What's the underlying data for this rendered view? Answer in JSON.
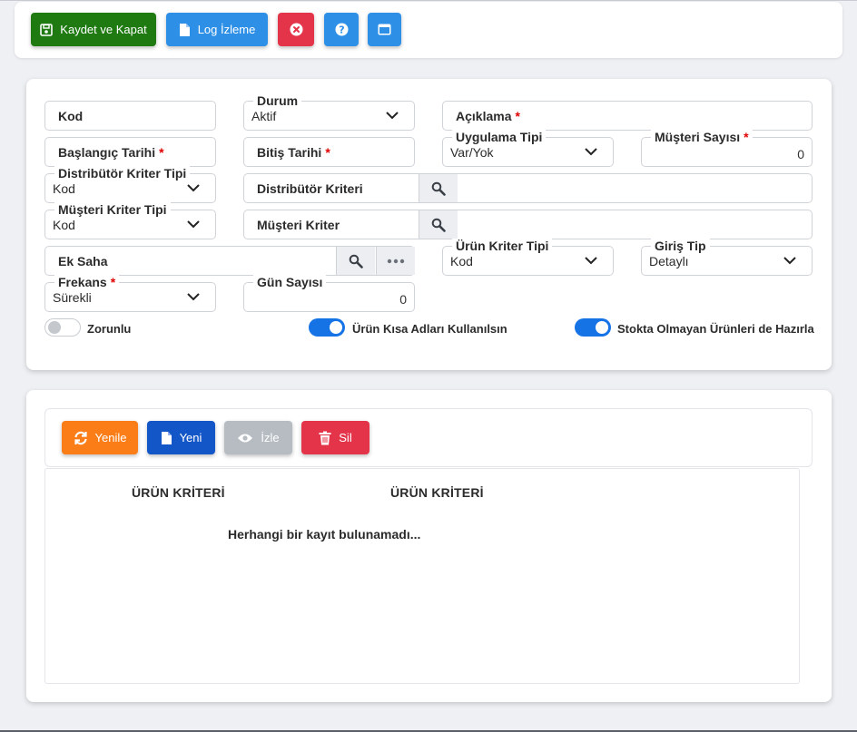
{
  "toolbar": {
    "save_close_label": "Kaydet ve Kapat",
    "log_label": "Log İzleme",
    "colors": {
      "success": "#1f7a12",
      "primary": "#2d8fe6",
      "danger": "#e3344a"
    },
    "icons": [
      "save-icon",
      "document-icon",
      "close-circle-icon",
      "help-icon",
      "window-icon"
    ]
  },
  "form": {
    "kod": {
      "placeholder": "Kod"
    },
    "durum": {
      "label": "Durum",
      "value": "Aktif"
    },
    "aciklama": {
      "placeholder": "Açıklama",
      "required_mark": "*"
    },
    "baslangic": {
      "placeholder": "Başlangıç Tarihi",
      "required_mark": "*"
    },
    "bitis": {
      "placeholder": "Bitiş Tarihi",
      "required_mark": "*"
    },
    "uygulama_tipi": {
      "label": "Uygulama Tipi",
      "value": "Var/Yok"
    },
    "musteri_sayisi": {
      "label": "Müşteri Sayısı",
      "required_mark": "*",
      "value": "0"
    },
    "distributor_kriter_tipi": {
      "label": "Distribütör Kriter Tipi",
      "value": "Kod"
    },
    "distributor_kriteri": {
      "placeholder": "Distribütör Kriteri",
      "value": ""
    },
    "musteri_kriter_tipi": {
      "label": "Müşteri Kriter Tipi",
      "value": "Kod"
    },
    "musteri_kriter": {
      "placeholder": "Müşteri Kriter",
      "value": ""
    },
    "ek_saha": {
      "placeholder": "Ek Saha"
    },
    "urun_kriter_tipi": {
      "label": "Ürün Kriter Tipi",
      "value": "Kod"
    },
    "giris_tip": {
      "label": "Giriş Tip",
      "value": "Detaylı"
    },
    "frekans": {
      "label": "Frekans",
      "required_mark": "*",
      "value": "Sürekli"
    },
    "gun_sayisi": {
      "label": "Gün Sayısı",
      "value": "0"
    }
  },
  "toggles": {
    "zorunlu": {
      "label": "Zorunlu",
      "checked": false
    },
    "urun_kisa_adlari": {
      "label": "Ürün Kısa Adları Kullanılsın",
      "checked": true
    },
    "stokta_olmayan": {
      "label": "Stokta Olmayan Ürünleri de Hazırla",
      "checked": true
    }
  },
  "grid": {
    "buttons": {
      "refresh": "Yenile",
      "new": "Yeni",
      "view": "İzle",
      "delete": "Sil"
    },
    "columns": [
      "ÜRÜN KRİTERİ",
      "ÜRÜN KRİTERİ"
    ],
    "empty_message": "Herhangi bir kayıt bulunamadı..."
  }
}
